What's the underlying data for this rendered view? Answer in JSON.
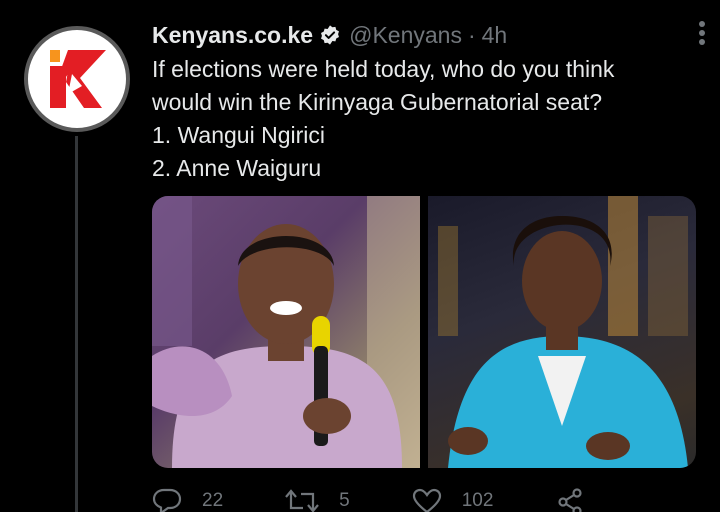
{
  "tweet": {
    "display_name": "Kenyans.co.ke",
    "handle": "@Kenyans",
    "separator": "·",
    "time": "4h",
    "lines": [
      "If elections were held today, who do you think",
      "would win the Kirinyaga Gubernatorial seat?",
      "1. Wangui Ngirici",
      "2. Anne Waiguru"
    ]
  },
  "avatar": {
    "brand_color": "#e31e24",
    "accent_color": "#f7941d",
    "icon": "kenyans-logo"
  },
  "colors": {
    "background": "#000000",
    "text": "#e7e9ea",
    "muted": "#71767b",
    "verified": "#e7e9ea"
  },
  "actions": {
    "reply_count": "22",
    "retweet_count": "5",
    "like_count": "102"
  }
}
